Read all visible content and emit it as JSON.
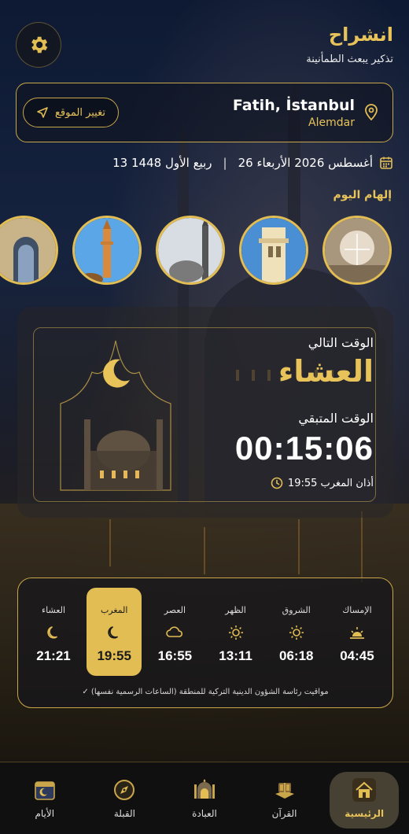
{
  "header": {
    "title": "انشراح",
    "subtitle": "تذكير يبعث الطمأنينة"
  },
  "location": {
    "city": "Fatih, İstanbul",
    "district": "Alemdar",
    "change_button": "تغيير الموقع"
  },
  "date": {
    "gregorian": "26 أغسطس 2026 الأربعاء",
    "separator": "|",
    "hijri": "13 ربيع الأول 1448"
  },
  "inspiration": {
    "title": "إلهام اليوم",
    "stories": [
      "chandelier-interior",
      "minaret-tower",
      "mosque-minarets",
      "minaret-top",
      "mihrab-arch"
    ]
  },
  "next_prayer": {
    "label": "الوقت التالي",
    "name": "العشاء",
    "remaining_label": "الوقت المتبقي",
    "countdown": "00:15:06",
    "adhan_text": "أذان المغرب 19:55"
  },
  "prayer_times": [
    {
      "name": "الإمساك",
      "time": "04:45",
      "icon": "sunrise-icon",
      "active": false
    },
    {
      "name": "الشروق",
      "time": "06:18",
      "icon": "sun-icon",
      "active": false
    },
    {
      "name": "الظهر",
      "time": "13:11",
      "icon": "sun-icon",
      "active": false
    },
    {
      "name": "العصر",
      "time": "16:55",
      "icon": "cloud-icon",
      "active": false
    },
    {
      "name": "المغرب",
      "time": "19:55",
      "icon": "moon-icon",
      "active": true
    },
    {
      "name": "العشاء",
      "time": "21:21",
      "icon": "moon-icon",
      "active": false
    }
  ],
  "times_note": "✓ مواقيت رئاسة الشؤون الدينية التركية للمنطقة (الساعات الرسمية نفسها)",
  "nav": [
    {
      "label": "الرئيسية",
      "icon": "home-icon",
      "active": true
    },
    {
      "label": "القرآن",
      "icon": "quran-icon",
      "active": false
    },
    {
      "label": "العبادة",
      "icon": "mosque-icon",
      "active": false
    },
    {
      "label": "القبلة",
      "icon": "compass-icon",
      "active": false
    },
    {
      "label": "الأيام",
      "icon": "calendar-icon",
      "active": false
    }
  ],
  "colors": {
    "accent": "#e7c35a",
    "active_bg": "#e2bd54",
    "background": "#16233f"
  }
}
